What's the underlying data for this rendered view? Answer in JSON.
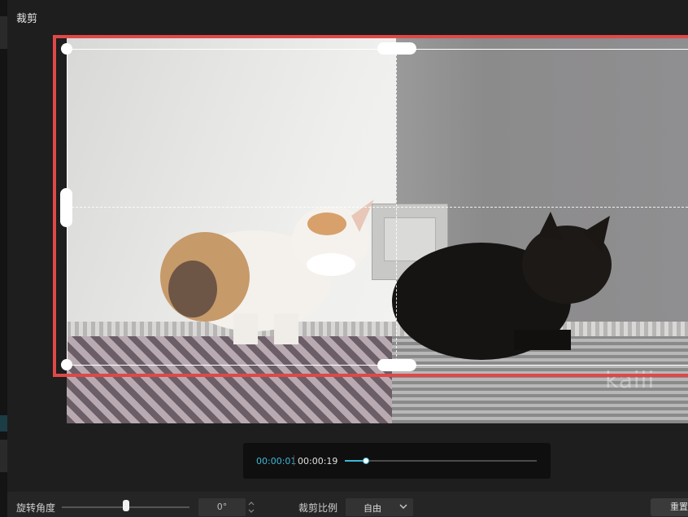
{
  "dialog": {
    "title": "裁剪"
  },
  "preview": {
    "watermark": "kaili"
  },
  "playback": {
    "current_time": "00:00:01",
    "total_time": "00:00:19",
    "progress": 0.11
  },
  "controls": {
    "rotation_label": "旋转角度",
    "rotation_value": "0°",
    "rotation_slider": 0.5,
    "ratio_label": "裁剪比例",
    "ratio_value": "自由",
    "reset_label": "重置"
  },
  "colors": {
    "accent": "#3fb7d8",
    "crop_outline": "#e04848"
  },
  "icons": [
    "chevron-up-icon",
    "chevron-down-icon"
  ]
}
